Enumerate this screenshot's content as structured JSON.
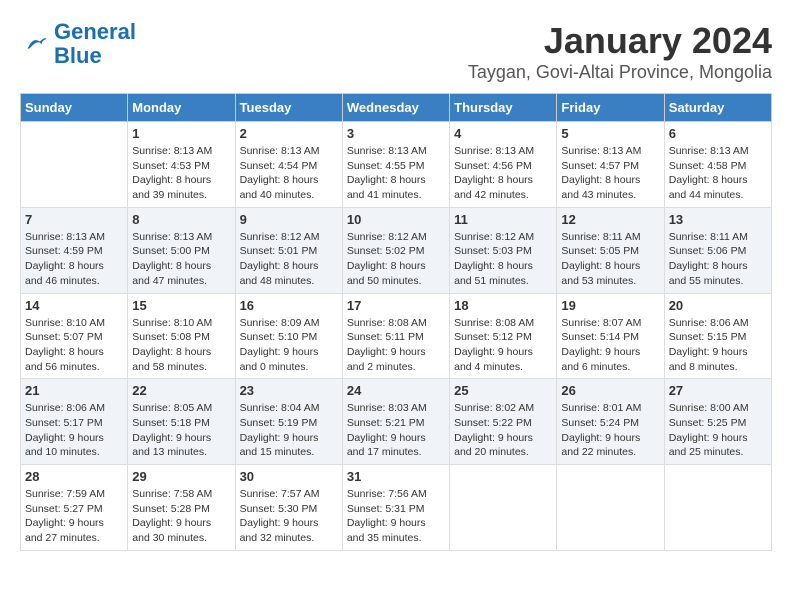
{
  "logo": {
    "line1": "General",
    "line2": "Blue"
  },
  "title": "January 2024",
  "subtitle": "Taygan, Govi-Altai Province, Mongolia",
  "weekdays": [
    "Sunday",
    "Monday",
    "Tuesday",
    "Wednesday",
    "Thursday",
    "Friday",
    "Saturday"
  ],
  "weeks": [
    [
      {
        "day": "",
        "info": ""
      },
      {
        "day": "1",
        "info": "Sunrise: 8:13 AM\nSunset: 4:53 PM\nDaylight: 8 hours\nand 39 minutes."
      },
      {
        "day": "2",
        "info": "Sunrise: 8:13 AM\nSunset: 4:54 PM\nDaylight: 8 hours\nand 40 minutes."
      },
      {
        "day": "3",
        "info": "Sunrise: 8:13 AM\nSunset: 4:55 PM\nDaylight: 8 hours\nand 41 minutes."
      },
      {
        "day": "4",
        "info": "Sunrise: 8:13 AM\nSunset: 4:56 PM\nDaylight: 8 hours\nand 42 minutes."
      },
      {
        "day": "5",
        "info": "Sunrise: 8:13 AM\nSunset: 4:57 PM\nDaylight: 8 hours\nand 43 minutes."
      },
      {
        "day": "6",
        "info": "Sunrise: 8:13 AM\nSunset: 4:58 PM\nDaylight: 8 hours\nand 44 minutes."
      }
    ],
    [
      {
        "day": "7",
        "info": "Sunrise: 8:13 AM\nSunset: 4:59 PM\nDaylight: 8 hours\nand 46 minutes."
      },
      {
        "day": "8",
        "info": "Sunrise: 8:13 AM\nSunset: 5:00 PM\nDaylight: 8 hours\nand 47 minutes."
      },
      {
        "day": "9",
        "info": "Sunrise: 8:12 AM\nSunset: 5:01 PM\nDaylight: 8 hours\nand 48 minutes."
      },
      {
        "day": "10",
        "info": "Sunrise: 8:12 AM\nSunset: 5:02 PM\nDaylight: 8 hours\nand 50 minutes."
      },
      {
        "day": "11",
        "info": "Sunrise: 8:12 AM\nSunset: 5:03 PM\nDaylight: 8 hours\nand 51 minutes."
      },
      {
        "day": "12",
        "info": "Sunrise: 8:11 AM\nSunset: 5:05 PM\nDaylight: 8 hours\nand 53 minutes."
      },
      {
        "day": "13",
        "info": "Sunrise: 8:11 AM\nSunset: 5:06 PM\nDaylight: 8 hours\nand 55 minutes."
      }
    ],
    [
      {
        "day": "14",
        "info": "Sunrise: 8:10 AM\nSunset: 5:07 PM\nDaylight: 8 hours\nand 56 minutes."
      },
      {
        "day": "15",
        "info": "Sunrise: 8:10 AM\nSunset: 5:08 PM\nDaylight: 8 hours\nand 58 minutes."
      },
      {
        "day": "16",
        "info": "Sunrise: 8:09 AM\nSunset: 5:10 PM\nDaylight: 9 hours\nand 0 minutes."
      },
      {
        "day": "17",
        "info": "Sunrise: 8:08 AM\nSunset: 5:11 PM\nDaylight: 9 hours\nand 2 minutes."
      },
      {
        "day": "18",
        "info": "Sunrise: 8:08 AM\nSunset: 5:12 PM\nDaylight: 9 hours\nand 4 minutes."
      },
      {
        "day": "19",
        "info": "Sunrise: 8:07 AM\nSunset: 5:14 PM\nDaylight: 9 hours\nand 6 minutes."
      },
      {
        "day": "20",
        "info": "Sunrise: 8:06 AM\nSunset: 5:15 PM\nDaylight: 9 hours\nand 8 minutes."
      }
    ],
    [
      {
        "day": "21",
        "info": "Sunrise: 8:06 AM\nSunset: 5:17 PM\nDaylight: 9 hours\nand 10 minutes."
      },
      {
        "day": "22",
        "info": "Sunrise: 8:05 AM\nSunset: 5:18 PM\nDaylight: 9 hours\nand 13 minutes."
      },
      {
        "day": "23",
        "info": "Sunrise: 8:04 AM\nSunset: 5:19 PM\nDaylight: 9 hours\nand 15 minutes."
      },
      {
        "day": "24",
        "info": "Sunrise: 8:03 AM\nSunset: 5:21 PM\nDaylight: 9 hours\nand 17 minutes."
      },
      {
        "day": "25",
        "info": "Sunrise: 8:02 AM\nSunset: 5:22 PM\nDaylight: 9 hours\nand 20 minutes."
      },
      {
        "day": "26",
        "info": "Sunrise: 8:01 AM\nSunset: 5:24 PM\nDaylight: 9 hours\nand 22 minutes."
      },
      {
        "day": "27",
        "info": "Sunrise: 8:00 AM\nSunset: 5:25 PM\nDaylight: 9 hours\nand 25 minutes."
      }
    ],
    [
      {
        "day": "28",
        "info": "Sunrise: 7:59 AM\nSunset: 5:27 PM\nDaylight: 9 hours\nand 27 minutes."
      },
      {
        "day": "29",
        "info": "Sunrise: 7:58 AM\nSunset: 5:28 PM\nDaylight: 9 hours\nand 30 minutes."
      },
      {
        "day": "30",
        "info": "Sunrise: 7:57 AM\nSunset: 5:30 PM\nDaylight: 9 hours\nand 32 minutes."
      },
      {
        "day": "31",
        "info": "Sunrise: 7:56 AM\nSunset: 5:31 PM\nDaylight: 9 hours\nand 35 minutes."
      },
      {
        "day": "",
        "info": ""
      },
      {
        "day": "",
        "info": ""
      },
      {
        "day": "",
        "info": ""
      }
    ]
  ]
}
